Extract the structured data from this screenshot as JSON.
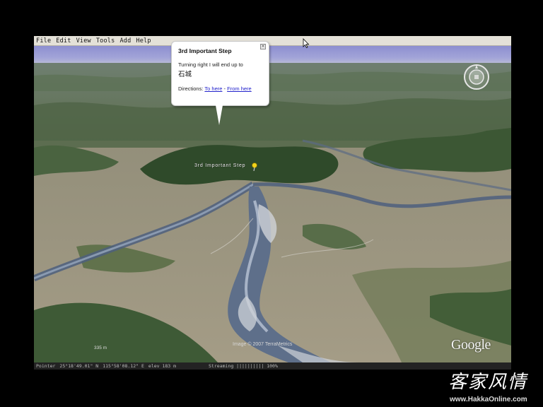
{
  "menu": {
    "items": [
      "File",
      "Edit",
      "View",
      "Tools",
      "Add",
      "Help"
    ]
  },
  "balloon": {
    "title": "3rd Important Step",
    "body": "Turning right I will end up to",
    "chinese_place": "石城",
    "directions_label": "Directions:",
    "to_here": "To here",
    "separator": "-",
    "from_here": "From here"
  },
  "placemark": {
    "label": "3rd Important Step",
    "pin_color": "#f2d21a"
  },
  "map": {
    "scale_label": "335 m",
    "imagery_credit": "Image © 2007 TerraMetrics",
    "logo": "Google"
  },
  "status": {
    "pointer": "Pointer",
    "lat": "25°18'49.01\" N",
    "lon": "115°58'08.12\" E",
    "elev": "elev  183 m",
    "streaming": "Streaming |||||||||| 100%"
  },
  "watermark": {
    "chinese": "客家风情",
    "url": "www.HakkaOnline.com"
  }
}
